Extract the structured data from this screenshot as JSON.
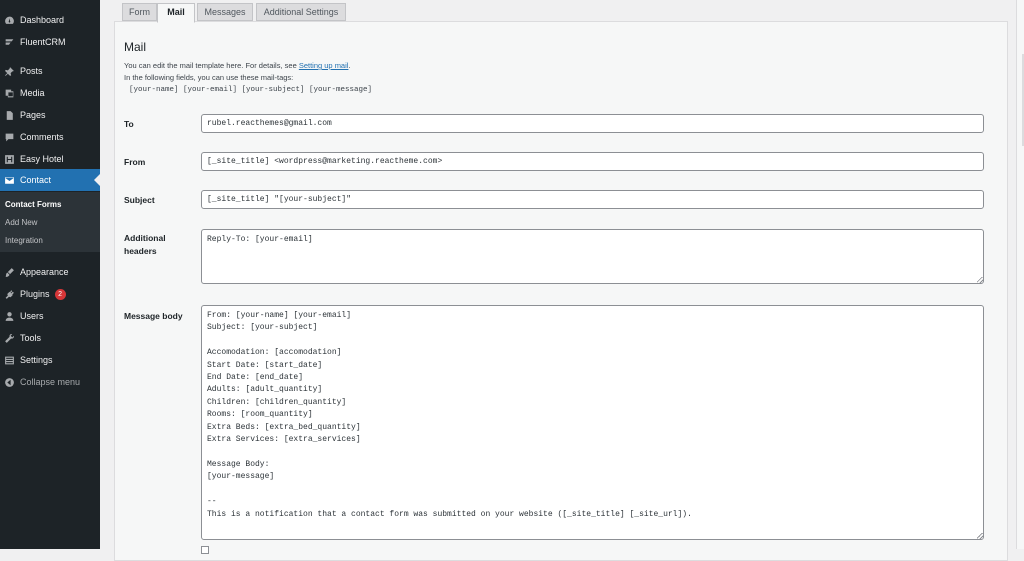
{
  "sidebar": {
    "items": [
      {
        "label": "Dashboard",
        "icon": "dashboard-icon",
        "active": false
      },
      {
        "label": "FluentCRM",
        "icon": "fluentcrm-icon",
        "active": false
      },
      {
        "label": "Posts",
        "icon": "pin-icon",
        "active": false
      },
      {
        "label": "Media",
        "icon": "media-icon",
        "active": false
      },
      {
        "label": "Pages",
        "icon": "page-icon",
        "active": false
      },
      {
        "label": "Comments",
        "icon": "comment-icon",
        "active": false
      },
      {
        "label": "Easy Hotel",
        "icon": "hotel-icon",
        "active": false
      },
      {
        "label": "Contact",
        "icon": "mail-icon",
        "active": true
      },
      {
        "label": "Appearance",
        "icon": "brush-icon",
        "active": false
      },
      {
        "label": "Plugins",
        "icon": "plugin-icon",
        "active": false,
        "badge": "2"
      },
      {
        "label": "Users",
        "icon": "user-icon",
        "active": false
      },
      {
        "label": "Tools",
        "icon": "wrench-icon",
        "active": false
      },
      {
        "label": "Settings",
        "icon": "settings-icon",
        "active": false
      },
      {
        "label": "Collapse menu",
        "icon": "collapse-icon",
        "active": false
      }
    ],
    "submenu": [
      "Contact Forms",
      "Add New",
      "Integration"
    ],
    "accent": "#2271b1",
    "background": "#1d2327"
  },
  "tabs": [
    "Form",
    "Mail",
    "Messages",
    "Additional Settings"
  ],
  "active_tab": "Mail",
  "mail": {
    "title": "Mail",
    "desc_line1_prefix": "You can edit the mail template here. For details, see ",
    "desc_link": "Setting up mail",
    "desc_line1_suffix": ".",
    "desc_line2": "In the following fields, you can use these mail-tags:",
    "mail_tags": "[your-name] [your-email] [your-subject] [your-message]",
    "to_label": "To",
    "to_value": "rubel.reacthemes@gmail.com",
    "from_label": "From",
    "from_value": "[_site_title] <wordpress@marketing.reactheme.com>",
    "subject_label": "Subject",
    "subject_value": "[_site_title] \"[your-subject]\"",
    "headers_label_1": "Additional",
    "headers_label_2": "headers",
    "headers_value": "Reply-To: [your-email]",
    "body_label": "Message body",
    "body_value": "From: [your-name] [your-email]\nSubject: [your-subject]\n\nAccomodation: [accomodation]\nStart Date: [start_date]\nEnd Date: [end_date]\nAdults: [adult_quantity]\nChildren: [children_quantity]\nRooms: [room_quantity]\nExtra Beds: [extra_bed_quantity]\nExtra Services: [extra_services]\n\nMessage Body:\n[your-message]\n\n--\nThis is a notification that a contact form was submitted on your website ([_site_title] [_site_url])."
  }
}
